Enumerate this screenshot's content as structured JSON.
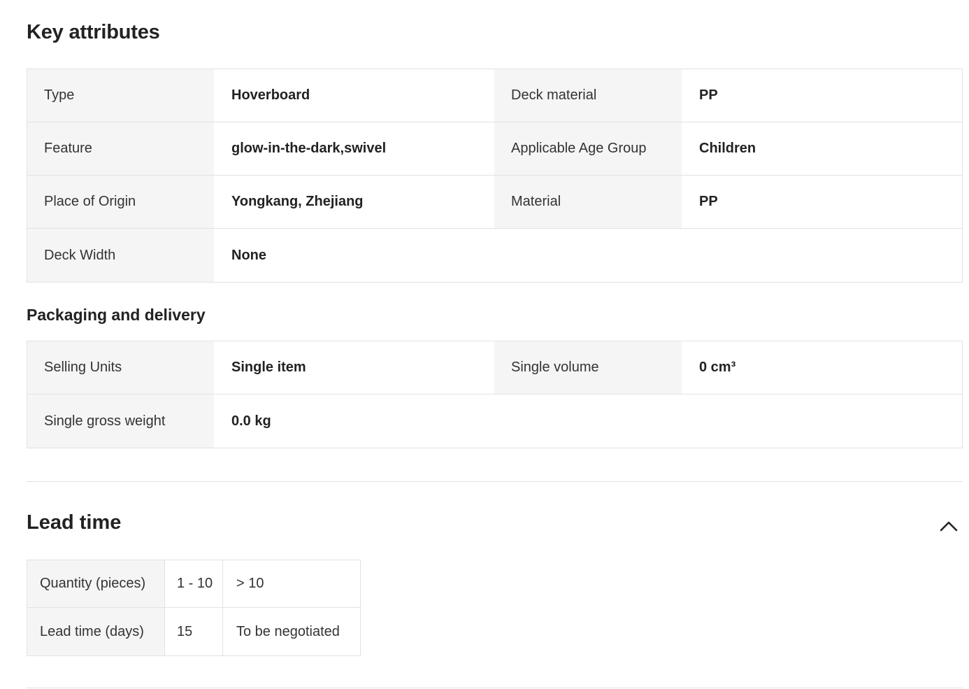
{
  "key_attributes": {
    "heading": "Key attributes",
    "rows": [
      [
        {
          "label": "Type",
          "value": "Hoverboard"
        },
        {
          "label": "Deck material",
          "value": "PP"
        }
      ],
      [
        {
          "label": "Feature",
          "value": "glow-in-the-dark,swivel"
        },
        {
          "label": "Applicable Age Group",
          "value": "Children"
        }
      ],
      [
        {
          "label": "Place of Origin",
          "value": "Yongkang, Zhejiang"
        },
        {
          "label": "Material",
          "value": "PP"
        }
      ],
      [
        {
          "label": "Deck Width",
          "value": "None"
        }
      ]
    ]
  },
  "packaging": {
    "heading": "Packaging and delivery",
    "rows": [
      [
        {
          "label": "Selling Units",
          "value": "Single item"
        },
        {
          "label": "Single volume",
          "value": "0 cm³"
        }
      ],
      [
        {
          "label": "Single gross weight",
          "value": "0.0 kg"
        }
      ]
    ]
  },
  "lead_time": {
    "heading": "Lead time",
    "collapse_icon": "chevron-up-icon",
    "table": {
      "rows": [
        [
          "Quantity (pieces)",
          "1 - 10",
          "> 10"
        ],
        [
          "Lead time (days)",
          "15",
          "To be negotiated"
        ]
      ]
    }
  }
}
